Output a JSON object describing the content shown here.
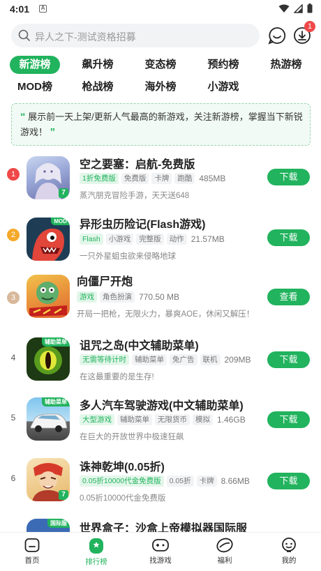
{
  "status_bar": {
    "time": "4:01",
    "a_icon": "A"
  },
  "search": {
    "placeholder": "异人之下-测试资格招募",
    "download_badge": "1"
  },
  "tabs": [
    "新游榜",
    "飙升榜",
    "变态榜",
    "预约榜",
    "热游榜",
    "MOD榜",
    "枪战榜",
    "海外榜",
    "小游戏"
  ],
  "active_tab": "新游榜",
  "notice": {
    "open_quote": "“",
    "text": "展示前一天上架/更新人气最高的新游戏，关注新游榜，掌握当下新锐游戏！",
    "close_quote": "”"
  },
  "games": [
    {
      "rank": "1",
      "title": "空之要塞：启航-免费版",
      "tags": [
        "1折免费版",
        "免费版",
        "卡牌",
        "跑酷"
      ],
      "size": "485MB",
      "desc": "蒸汽朋克冒险手游，天天送648",
      "button": "下载",
      "mod": "",
      "rank_color": "#f04848"
    },
    {
      "rank": "2",
      "title": "异形虫历险记(Flash游戏)",
      "tags": [
        "Flash",
        "小游戏",
        "完整版",
        "动作"
      ],
      "size": "21.57MB",
      "desc": "一只外星蛆虫欲来侵略地球",
      "button": "下载",
      "mod": "MOD",
      "rank_color": "#f4a92a"
    },
    {
      "rank": "3",
      "title": "向僵尸开炮",
      "tags": [
        "游戏",
        "角色扮演"
      ],
      "size": "770.50 MB",
      "desc": "开局一把枪，无限火力，暴爽AOE，休闲又解压！",
      "button": "查看",
      "mod": "",
      "rank_color": "#d8b89a"
    },
    {
      "rank": "4",
      "title": "诅咒之岛(中文辅助菜单)",
      "tags": [
        "无需等待计时",
        "辅助菜单",
        "免广告",
        "联机"
      ],
      "size": "209MB",
      "desc": "在这最重要的是生存!",
      "button": "下载",
      "mod": "辅助菜单",
      "rank_color": ""
    },
    {
      "rank": "5",
      "title": "多人汽车驾驶游戏(中文辅助菜单)",
      "tags": [
        "大型游戏",
        "辅助菜单",
        "无限货币",
        "模拟"
      ],
      "size": "1.46GB",
      "desc": "在巨大的开放世界中极速狂飙",
      "button": "下载",
      "mod": "辅助菜单",
      "rank_color": ""
    },
    {
      "rank": "6",
      "title": "诛神乾坤(0.05折)",
      "tags": [
        "0.05折10000代金免费版",
        "0.05折",
        "卡牌"
      ],
      "size": "8.66MB",
      "desc": "0.05折10000代金免费版",
      "button": "下载",
      "mod": "",
      "rank_color": ""
    },
    {
      "rank": "",
      "title": "世界盒子：沙盒上帝模拟器国际服",
      "tags": [],
      "size": "",
      "desc": "",
      "button": "",
      "mod": "国际服",
      "rank_color": ""
    }
  ],
  "bottom_nav": [
    {
      "label": "首页",
      "icon": "home-icon"
    },
    {
      "label": "排行榜",
      "icon": "ranking-icon"
    },
    {
      "label": "找游戏",
      "icon": "gamepad-icon"
    },
    {
      "label": "福利",
      "icon": "gift-icon"
    },
    {
      "label": "我的",
      "icon": "profile-icon"
    }
  ],
  "colors": {
    "accent": "#21b35d",
    "badge": "#f04848"
  }
}
